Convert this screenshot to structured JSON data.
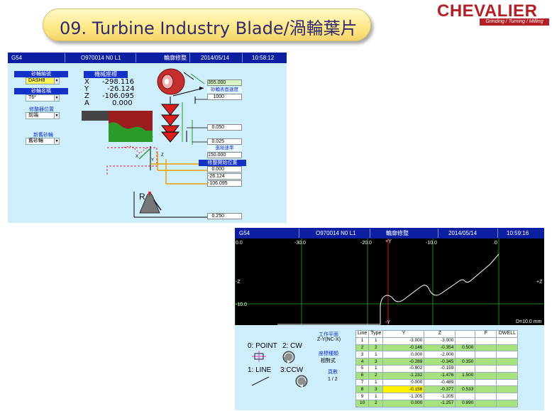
{
  "slide": {
    "title": "09. Turbine Industry Blade/渦輪葉片",
    "logo": {
      "name": "CHEVALIER",
      "tagline": "Grinding / Turning / Milling"
    }
  },
  "screen1": {
    "topbar": {
      "code": "G54",
      "program": "O970014 N0 L1",
      "mode": "輪廓修整",
      "date": "2014/05/14",
      "time": "10:58:12"
    },
    "wheel_select": {
      "label": "砂輪編號",
      "value": "DASH8"
    },
    "wheel_name": {
      "label": "砂輪名稱",
      "value": "T6*"
    },
    "dresser_pos": {
      "label": "修整器位置",
      "value": "前端"
    },
    "new_wheel": {
      "label": "新舊砂輪",
      "value": "舊砂輪"
    },
    "machine_coord": {
      "label": "機械座標",
      "axes": [
        {
          "axis": "X",
          "value": "-298.116"
        },
        {
          "axis": "Y",
          "value": "-26.124"
        },
        {
          "axis": "Z",
          "value": "-106.095"
        },
        {
          "axis": "A",
          "value": "0.000"
        }
      ]
    },
    "wheel_dia": "355.000",
    "surface_speed_label": "砂輪表面速度",
    "surface_speed": "1000",
    "depth1": "0.050",
    "depth2": "0.025",
    "feed_label": "進給速率",
    "feed": "150.000",
    "dress_start_label": "修整開始位置",
    "dress_start": [
      "0.000",
      "-26.124",
      "-106.095"
    ],
    "radius_label": "R",
    "radius": "0.250",
    "diagram_axes": {
      "x": "X",
      "y": "Y",
      "z": "Z"
    }
  },
  "screen2": {
    "topbar": {
      "code": "G54",
      "program": "O970014 N0 L1",
      "mode": "輪廓修整",
      "date": "2014/05/14",
      "time": "10:59:16"
    },
    "plot": {
      "x_ticks": [
        "-30.0",
        "-20.0",
        "-10.0",
        ".0"
      ],
      "left_edge_tick": "0.0",
      "y_ticks": [
        "-Z",
        "-10.0"
      ],
      "plus_y": "+Y",
      "minus_y": "-Y",
      "plus_z": "+Z",
      "scale": "D=10.0 mm"
    },
    "shapes": {
      "point": "0: POINT",
      "cw": "2: CW",
      "line": "1: LINE",
      "ccw": "3:CCW"
    },
    "work_plane_label": "工作平面",
    "work_plane_value": "Z-Y(NC-X)",
    "coord_type_label": "座標種類",
    "coord_type_value": "相對式",
    "pages_label": "頁數",
    "pages_value": "1 / 2",
    "table": {
      "headers": [
        "Line",
        "Type",
        "Y",
        "Z",
        "",
        "F",
        "DWELL"
      ],
      "rows": [
        {
          "line": "1",
          "type": "1",
          "y": "-3.000",
          "z": "-3.000",
          "r": "",
          "f": "",
          "dwell": ""
        },
        {
          "line": "2",
          "type": "2",
          "y": "-0.146",
          "z": "-0.354",
          "r": "0.500",
          "f": "",
          "dwell": ""
        },
        {
          "line": "3",
          "type": "1",
          "y": "0.000",
          "z": "-2.000",
          "r": "",
          "f": "",
          "dwell": ""
        },
        {
          "line": "4",
          "type": "3",
          "y": "-0.289",
          "z": "-0.345",
          "r": "0.350",
          "f": "",
          "dwell": ""
        },
        {
          "line": "5",
          "type": "1",
          "y": "-0.902",
          "z": "-0.159",
          "r": "",
          "f": "",
          "dwell": ""
        },
        {
          "line": "6",
          "type": "2",
          "y": "-1.232",
          "z": "-1.476",
          "r": "1.500",
          "f": "",
          "dwell": ""
        },
        {
          "line": "7",
          "type": "1",
          "y": "0.000",
          "z": "-0.489",
          "r": "",
          "f": "",
          "dwell": ""
        },
        {
          "line": "8",
          "type": "3",
          "y": "-0.156",
          "z": "-0.377",
          "r": "0.533",
          "f": "",
          "dwell": ""
        },
        {
          "line": "9",
          "type": "1",
          "y": "-1.205",
          "z": "-1.205",
          "r": "",
          "f": "",
          "dwell": ""
        },
        {
          "line": "10",
          "type": "2",
          "y": "0.000",
          "z": "-1.257",
          "r": "0.890",
          "f": "",
          "dwell": ""
        }
      ]
    }
  },
  "colors": {
    "screen_bg": "#cfeefb",
    "topbar": "#0b1fa0",
    "row_highlight": "#a6e37e",
    "selected_cell": "#fff200",
    "logo_red": "#b21f24"
  }
}
